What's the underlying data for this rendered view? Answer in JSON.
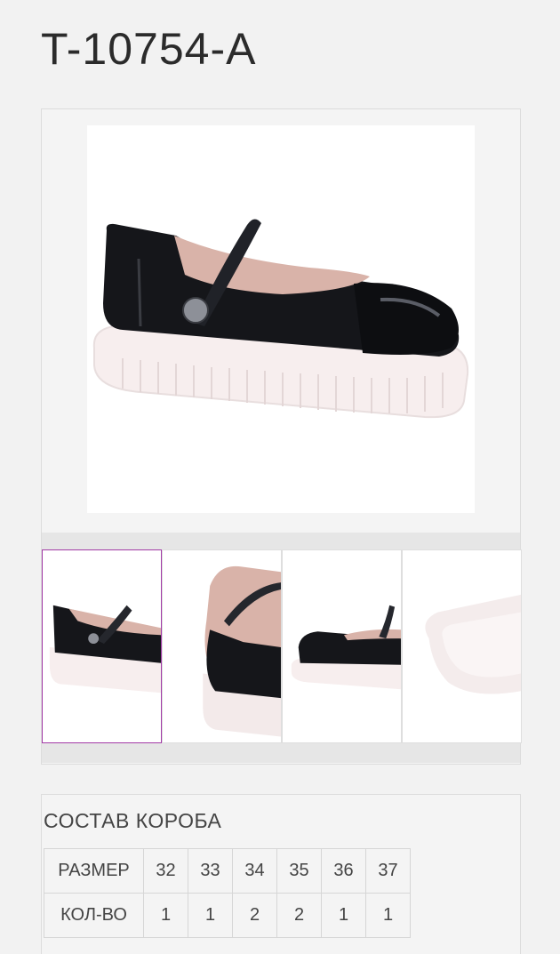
{
  "product": {
    "code": "T-10754-A"
  },
  "gallery": {
    "main_image": "black mary jane shoe with white platform sole",
    "thumbnails": [
      {
        "label": "side view",
        "selected": true
      },
      {
        "label": "front view",
        "selected": false
      },
      {
        "label": "angled view",
        "selected": false
      },
      {
        "label": "sole view",
        "selected": false
      }
    ],
    "selected_border_color": "#a23aa6"
  },
  "box": {
    "title": "СОСТАВ КОРОБА",
    "size_label": "РАЗМЕР",
    "qty_label": "КОЛ-ВО",
    "sizes": [
      "32",
      "33",
      "34",
      "35",
      "36",
      "37"
    ],
    "quantities": [
      "1",
      "1",
      "2",
      "2",
      "1",
      "1"
    ]
  }
}
